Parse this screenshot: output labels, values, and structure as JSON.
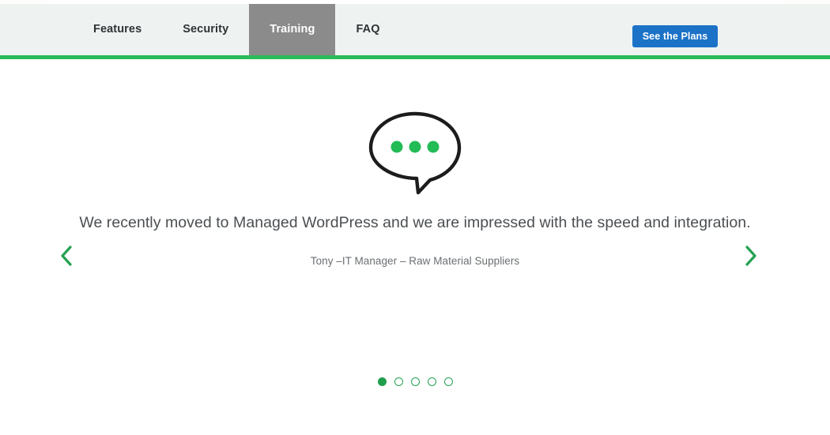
{
  "navbar": {
    "items": [
      {
        "label": "Features",
        "active": false
      },
      {
        "label": "Security",
        "active": false
      },
      {
        "label": "Training",
        "active": true
      },
      {
        "label": "FAQ",
        "active": false
      }
    ],
    "cta_label": "See the Plans",
    "background_color": "#eef3f2",
    "active_tab_color": "#8b8b8b",
    "cta_color": "#1b72c7",
    "accent_rule_color": "#2cbb59"
  },
  "testimonial": {
    "icon": "speech-bubble-icon",
    "icon_dot_color": "#22bb55",
    "icon_outline_color": "#1c1c1c",
    "quote": "We recently moved to Managed WordPress and we are impressed with the speed and integration.",
    "author": "Tony –IT Manager – Raw Material Suppliers",
    "prev_icon": "chevron-left-icon",
    "next_icon": "chevron-right-icon",
    "arrow_color": "#25a152",
    "slides": [
      {
        "active": true
      },
      {
        "active": false
      },
      {
        "active": false
      },
      {
        "active": false
      },
      {
        "active": false
      }
    ],
    "dot_color": "#25a152"
  }
}
